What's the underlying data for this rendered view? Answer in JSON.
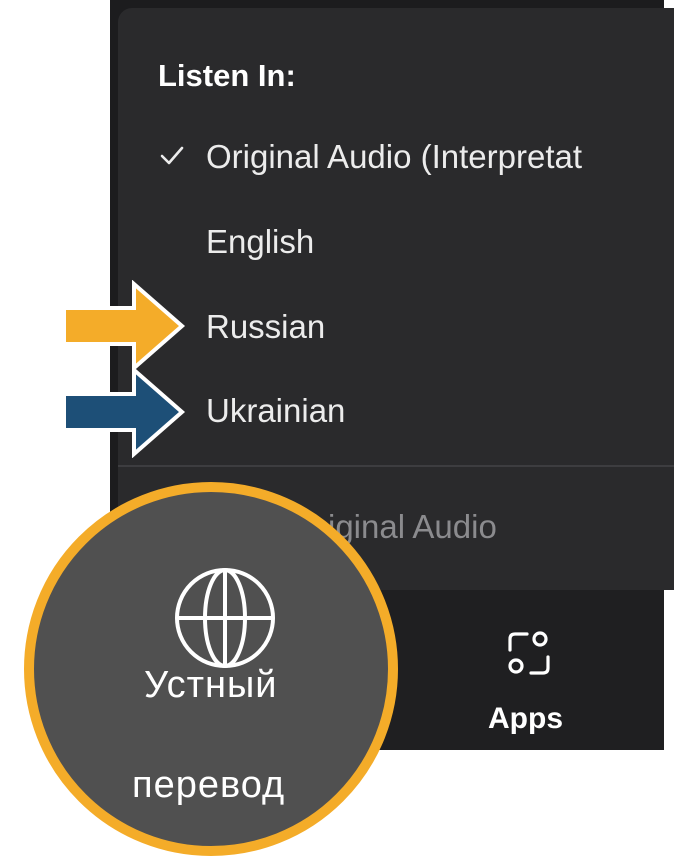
{
  "menu": {
    "header": "Listen In:",
    "items": [
      {
        "label": "Original Audio (Interpretat",
        "checked": true
      },
      {
        "label": "English",
        "checked": false
      },
      {
        "label": "Russian",
        "checked": false
      },
      {
        "label": "Ukrainian",
        "checked": false
      }
    ],
    "secondary_item": "iginal Audio"
  },
  "toolbar": {
    "apps_label": "Apps",
    "apps_icon": "apps-icon"
  },
  "annotations": {
    "arrow_russian_color": "#f4ac29",
    "arrow_ukrainian_color": "#1d4f77"
  },
  "badge": {
    "icon": "globe-icon",
    "line1": "Устный",
    "line2": "перевод",
    "ring_color": "#f4ac29",
    "fill_color": "#505050"
  }
}
